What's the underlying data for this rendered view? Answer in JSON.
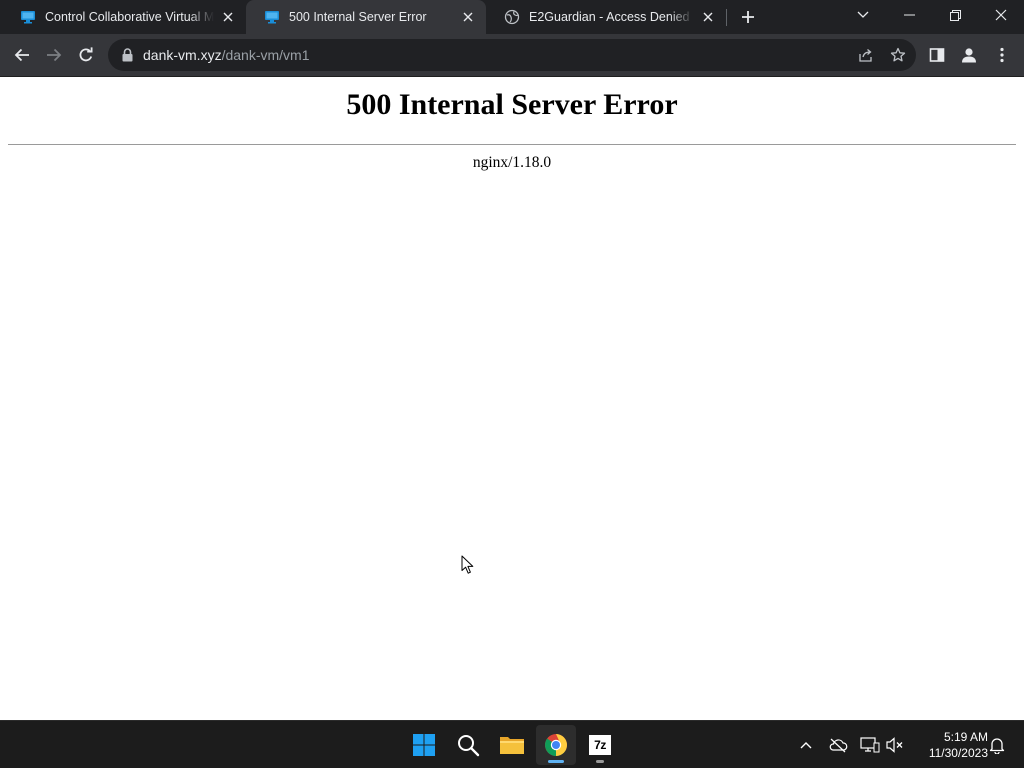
{
  "browser": {
    "tabs": [
      {
        "title": "Control Collaborative Virtual Machine",
        "favicon": "monitor-icon",
        "active": false
      },
      {
        "title": "500 Internal Server Error",
        "favicon": "monitor-icon",
        "active": true
      },
      {
        "title": "E2Guardian - Access Denied",
        "favicon": "globe-icon",
        "active": false
      }
    ],
    "omnibox": {
      "host": "dank-vm.xyz",
      "path": "/dank-vm/vm1"
    }
  },
  "page": {
    "heading": "500 Internal Server Error",
    "server": "nginx/1.18.0"
  },
  "taskbar": {
    "apps": [
      "windows-start-icon",
      "search-icon",
      "file-explorer-icon",
      "chrome-icon",
      "7zip-icon"
    ],
    "seven_zip_label": "7z",
    "clock": {
      "time": "5:19 AM",
      "date": "11/30/2023"
    }
  },
  "colors": {
    "tabstrip_bg": "#202124",
    "toolbar_bg": "#35363a",
    "text_light": "#e8eaed",
    "page_bg": "#ffffff",
    "taskbar_bg": "#1c1c1c",
    "windows_blue": "#1ea0f2",
    "folder_yellow": "#f5c13c"
  }
}
